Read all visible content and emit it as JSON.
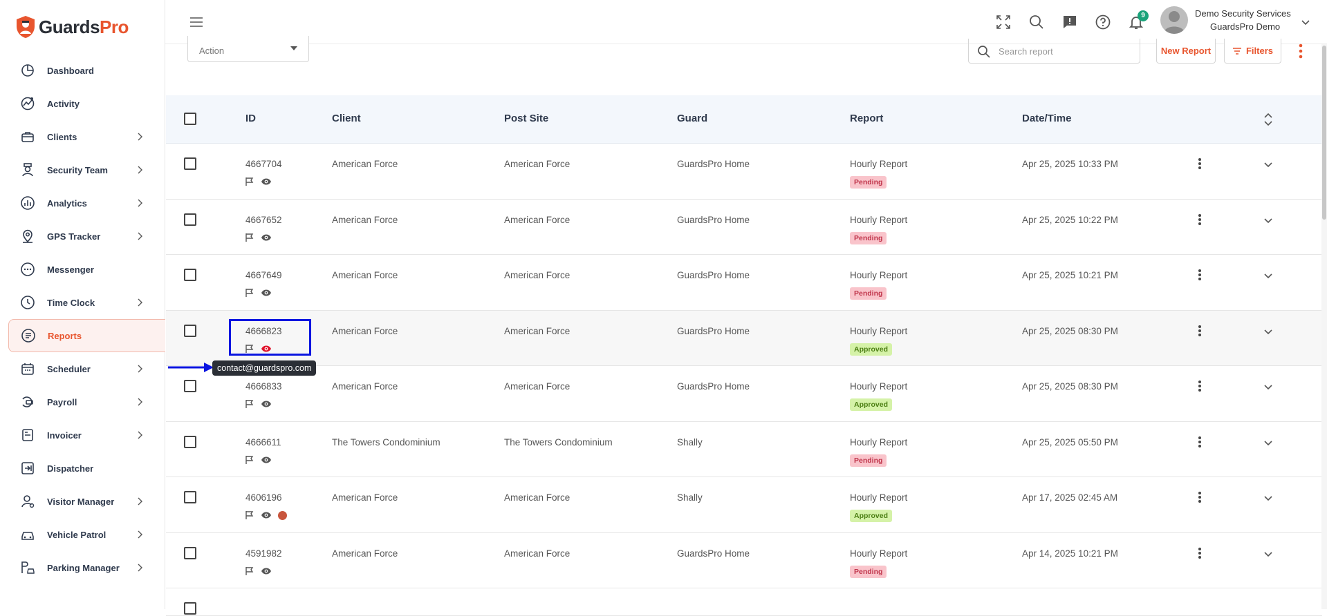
{
  "brand": {
    "name_part1": "Guards",
    "name_part2": "Pro",
    "accent": "#e8552e"
  },
  "sidebar": {
    "items": [
      {
        "label": "Dashboard",
        "icon": "dashboard-icon",
        "has_submenu": false
      },
      {
        "label": "Activity",
        "icon": "activity-icon",
        "has_submenu": false
      },
      {
        "label": "Clients",
        "icon": "briefcase-icon",
        "has_submenu": true
      },
      {
        "label": "Security Team",
        "icon": "guard-icon",
        "has_submenu": true
      },
      {
        "label": "Analytics",
        "icon": "analytics-icon",
        "has_submenu": true
      },
      {
        "label": "GPS Tracker",
        "icon": "map-pin-icon",
        "has_submenu": true
      },
      {
        "label": "Messenger",
        "icon": "chat-icon",
        "has_submenu": false
      },
      {
        "label": "Time Clock",
        "icon": "clock-icon",
        "has_submenu": true
      },
      {
        "label": "Reports",
        "icon": "report-icon",
        "has_submenu": false,
        "active": true
      },
      {
        "label": "Scheduler",
        "icon": "calendar-icon",
        "has_submenu": true
      },
      {
        "label": "Payroll",
        "icon": "payroll-icon",
        "has_submenu": true
      },
      {
        "label": "Invoicer",
        "icon": "invoice-icon",
        "has_submenu": true
      },
      {
        "label": "Dispatcher",
        "icon": "dispatch-icon",
        "has_submenu": false
      },
      {
        "label": "Visitor Manager",
        "icon": "visitor-icon",
        "has_submenu": true
      },
      {
        "label": "Vehicle Patrol",
        "icon": "car-icon",
        "has_submenu": true
      },
      {
        "label": "Parking Manager",
        "icon": "parking-icon",
        "has_submenu": true
      }
    ]
  },
  "topbar": {
    "notification_count": "9",
    "user_name": "Demo Security Services",
    "user_org": "GuardsPro Demo"
  },
  "toolbar": {
    "action_label": "Action",
    "search_placeholder": "Search report",
    "new_report_label": "New Report",
    "filters_label": "Filters"
  },
  "table": {
    "headers": {
      "id": "ID",
      "client": "Client",
      "post_site": "Post Site",
      "guard": "Guard",
      "report": "Report",
      "datetime": "Date/Time"
    },
    "rows": [
      {
        "id": "4667704",
        "client": "American Force",
        "post_site": "American Force",
        "guard": "GuardsPro Home",
        "report": "Hourly Report",
        "status": "Pending",
        "datetime": "Apr 25, 2025 10:33 PM"
      },
      {
        "id": "4667652",
        "client": "American Force",
        "post_site": "American Force",
        "guard": "GuardsPro Home",
        "report": "Hourly Report",
        "status": "Pending",
        "datetime": "Apr 25, 2025 10:22 PM"
      },
      {
        "id": "4667649",
        "client": "American Force",
        "post_site": "American Force",
        "guard": "GuardsPro Home",
        "report": "Hourly Report",
        "status": "Pending",
        "datetime": "Apr 25, 2025 10:21 PM"
      },
      {
        "id": "4666823",
        "client": "American Force",
        "post_site": "American Force",
        "guard": "GuardsPro Home",
        "report": "Hourly Report",
        "status": "Approved",
        "datetime": "Apr 25, 2025 08:30 PM"
      },
      {
        "id": "4666833",
        "client": "American Force",
        "post_site": "American Force",
        "guard": "GuardsPro Home",
        "report": "Hourly Report",
        "status": "Approved",
        "datetime": "Apr 25, 2025 08:30 PM"
      },
      {
        "id": "4666611",
        "client": "The Towers Condominium",
        "post_site": "The Towers Condominium",
        "guard": "Shally",
        "report": "Hourly Report",
        "status": "Pending",
        "datetime": "Apr 25, 2025 05:50 PM"
      },
      {
        "id": "4606196",
        "client": "American Force",
        "post_site": "American Force",
        "guard": "Shally",
        "report": "Hourly Report",
        "status": "Approved",
        "datetime": "Apr 17, 2025 02:45 AM"
      },
      {
        "id": "4591982",
        "client": "American Force",
        "post_site": "American Force",
        "guard": "GuardsPro Home",
        "report": "Hourly Report",
        "status": "Pending",
        "datetime": "Apr 14, 2025 10:21 PM"
      }
    ]
  },
  "tooltip": {
    "text": "contact@guardspro.com"
  }
}
